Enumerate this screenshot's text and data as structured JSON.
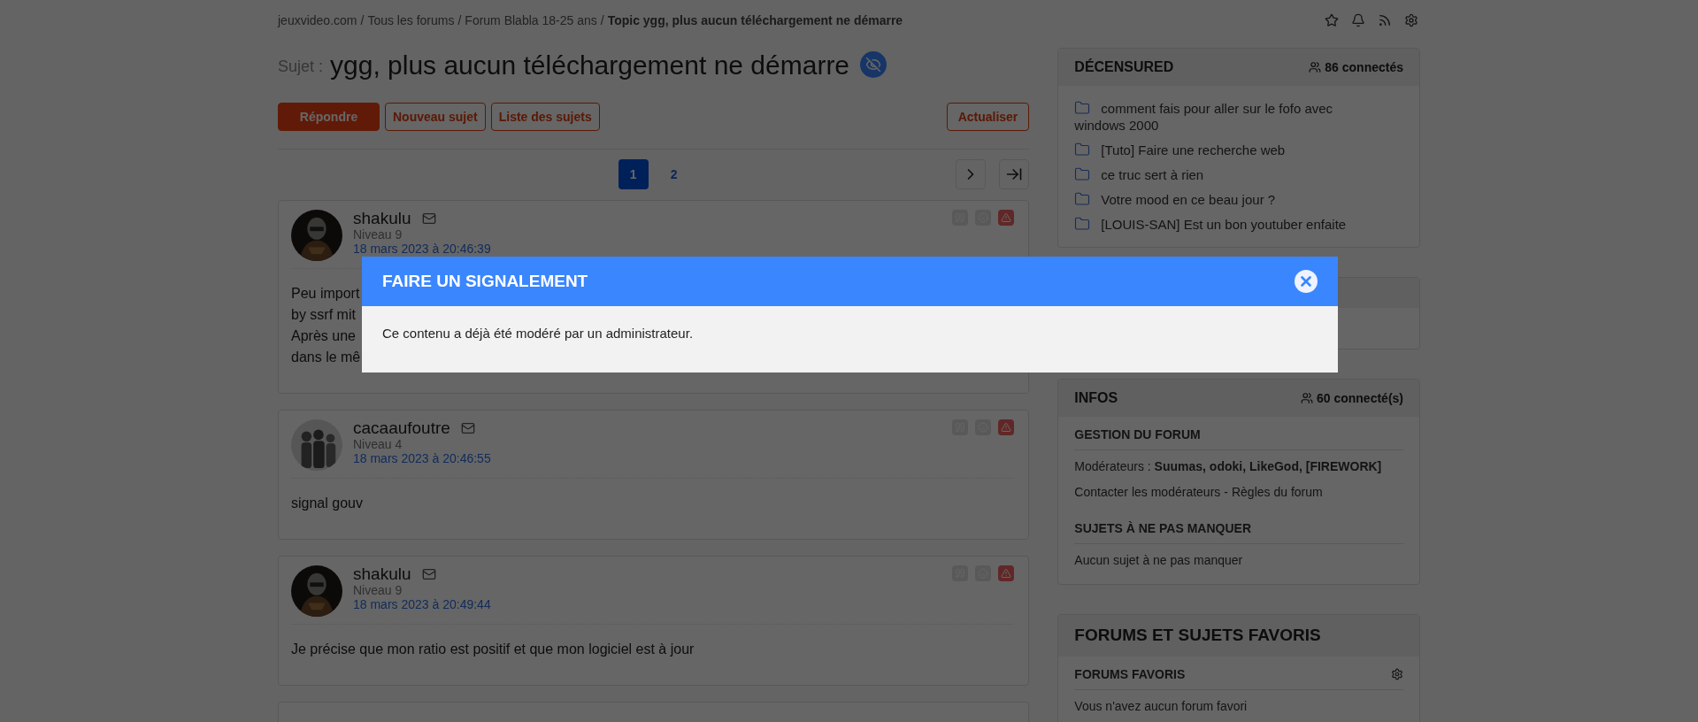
{
  "breadcrumb": {
    "separator": "/",
    "items": [
      {
        "text": "jeuxvideo.com",
        "current": false
      },
      {
        "text": "Tous les forums",
        "current": false
      },
      {
        "text": "Forum Blabla 18-25 ans",
        "current": false
      },
      {
        "text": "Topic ygg, plus aucun téléchargement ne démarre",
        "current": true
      }
    ]
  },
  "topic": {
    "label": "Sujet :",
    "title": "ygg, plus aucun téléchargement ne démarre"
  },
  "actions": [
    {
      "label": "Répondre",
      "kind": "primary"
    },
    {
      "label": "Nouveau sujet",
      "kind": "outline"
    },
    {
      "label": "Liste des sujets",
      "kind": "outline"
    }
  ],
  "refresh": {
    "label": "Actualiser"
  },
  "pagination": [
    {
      "label": "1",
      "selected": true
    },
    {
      "label": "2",
      "selected": false
    }
  ],
  "posts": [
    {
      "author": "shakulu",
      "level": "Niveau 9",
      "date": "18 mars 2023 à 20:46:39",
      "body": [
        "Peu import",
        "by ssrf mit",
        "Après une",
        "dans le mê"
      ]
    },
    {
      "author": "cacaaufoutre",
      "level": "Niveau 4",
      "date": "18 mars 2023 à 20:46:55",
      "body": [
        "signal gouv"
      ]
    },
    {
      "author": "shakulu",
      "level": "Niveau 9",
      "date": "18 mars 2023 à 20:49:44",
      "body": [
        "Je précise que mon ratio est positif et que mon logiciel est à jour"
      ]
    }
  ],
  "sidebar": [
    {
      "kind": "topics",
      "title": "DÉCENSURED",
      "count": "86 connectés",
      "topics": [
        "comment fais pour aller sur le fofo avec windows 2000",
        "[Tuto] Faire une recherche web",
        "ce truc sert à rien",
        "Votre mood en ce beau jour ?",
        "[LOUIS-SAN] Est un bon youtuber enfaite"
      ]
    },
    {
      "kind": "blank"
    },
    {
      "kind": "info",
      "title": "INFOS",
      "count": "60 connecté(s)",
      "sections": [
        {
          "heading": "GESTION DU FORUM",
          "lines": [
            {
              "kind": "text",
              "text": "Modérateurs : **Suumas, odoki, LikeGod, [FIREWORK]**"
            },
            {
              "kind": "links",
              "separator": "-",
              "links": [
                "Contacter les modérateurs",
                "Règles du forum"
              ]
            }
          ]
        },
        {
          "heading": "SUJETS À NE PAS MANQUER",
          "lines": [
            {
              "kind": "text",
              "text": "Aucun sujet à ne pas manquer"
            }
          ]
        }
      ]
    },
    {
      "kind": "info",
      "title": "FORUMS ET SUJETS FAVORIS",
      "sections": [
        {
          "heading": "FORUMS FAVORIS",
          "settings": true,
          "lines": [
            {
              "kind": "text",
              "text": "Vous n'avez aucun forum favori"
            }
          ]
        }
      ]
    }
  ],
  "modal": {
    "title": "FAIRE UN SIGNALEMENT",
    "message": "Ce contenu a déjà été modéré par un administrateur."
  }
}
